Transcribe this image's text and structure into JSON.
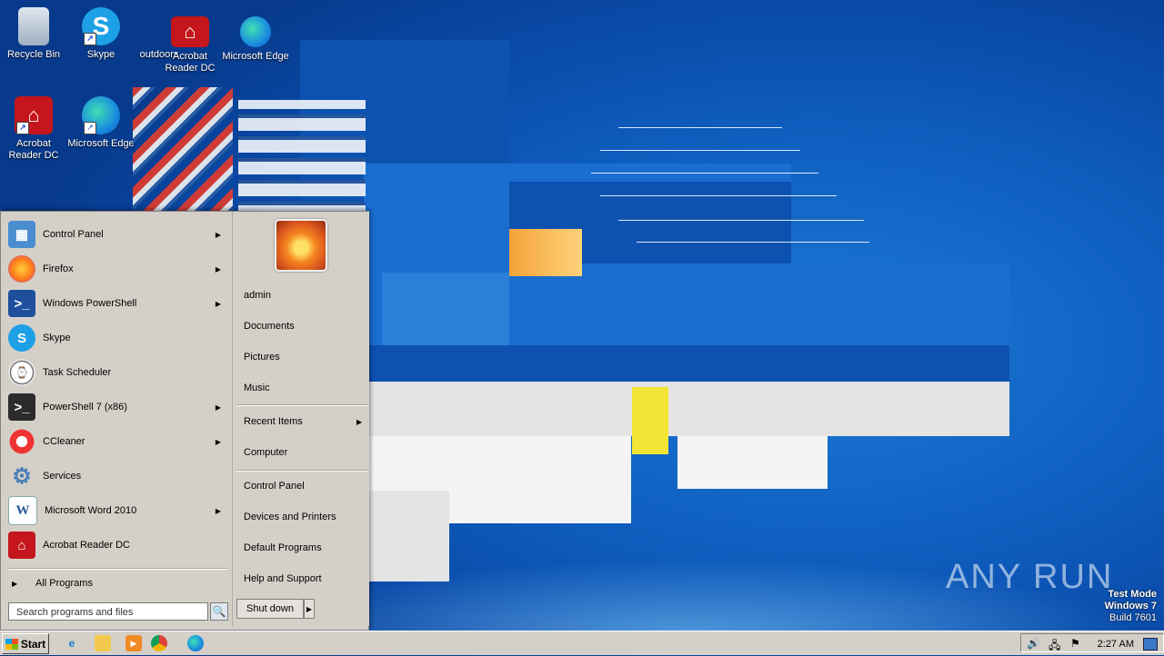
{
  "desktop": {
    "icons": [
      {
        "label": "Recycle Bin"
      },
      {
        "label": "Skype"
      },
      {
        "label": "outdoors"
      },
      {
        "label": "Acrobat Reader DC"
      },
      {
        "label": "Microsoft Edge"
      },
      {
        "label": "Acrobat Reader DC"
      },
      {
        "label": "Microsoft Edge"
      }
    ]
  },
  "start_menu": {
    "programs": [
      {
        "label": "Control Panel",
        "has_submenu": true
      },
      {
        "label": "Firefox",
        "has_submenu": true
      },
      {
        "label": "Windows PowerShell",
        "has_submenu": true
      },
      {
        "label": "Skype",
        "has_submenu": false
      },
      {
        "label": "Task Scheduler",
        "has_submenu": false
      },
      {
        "label": "PowerShell 7 (x86)",
        "has_submenu": true
      },
      {
        "label": "CCleaner",
        "has_submenu": true
      },
      {
        "label": "Services",
        "has_submenu": false
      },
      {
        "label": "Microsoft Word 2010",
        "has_submenu": true
      },
      {
        "label": "Acrobat Reader DC",
        "has_submenu": false
      }
    ],
    "all_programs": "All Programs",
    "search_placeholder": "Search programs and files",
    "right_links": [
      {
        "label": "admin"
      },
      {
        "label": "Documents"
      },
      {
        "label": "Pictures"
      },
      {
        "label": "Music"
      },
      {
        "label": "Recent Items"
      },
      {
        "label": "Computer"
      },
      {
        "label": "Control Panel"
      },
      {
        "label": "Devices and Printers"
      },
      {
        "label": "Default Programs"
      },
      {
        "label": "Help and Support"
      }
    ],
    "shutdown": "Shut down"
  },
  "taskbar": {
    "start_label": "Start",
    "clock": "2:27 AM"
  },
  "watermark": {
    "line1": "Test Mode",
    "line2": "Windows 7",
    "line3": "Build 7601",
    "brand": "ANY RUN"
  },
  "colors": {
    "desktop": "#0f5fc0",
    "menu": "#d4d0c8"
  }
}
